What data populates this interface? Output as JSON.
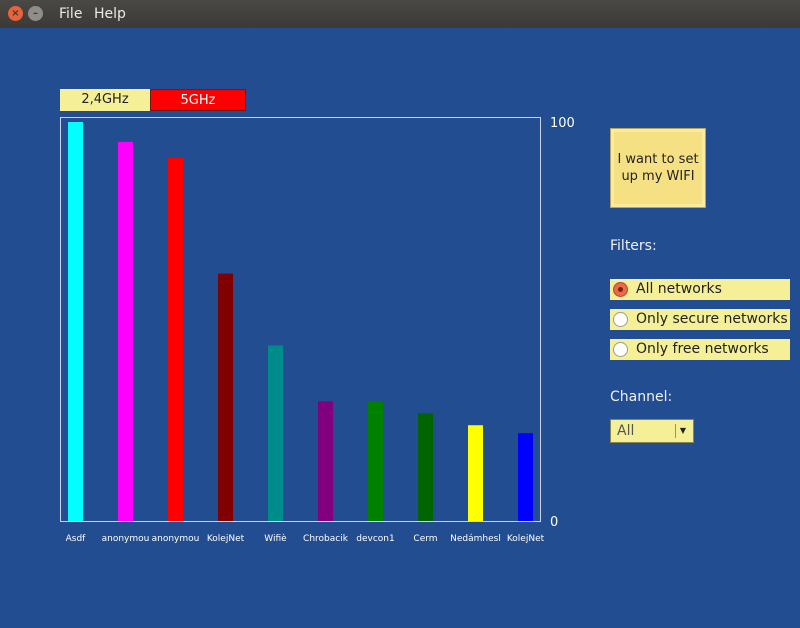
{
  "menu": {
    "file": "File",
    "help": "Help"
  },
  "bands": {
    "band_24": "2,4GHz",
    "band_5": "5GHz"
  },
  "setup_button_label": "I want to set up my WIFI",
  "filters": {
    "label": "Filters:",
    "options": [
      {
        "label": "All networks",
        "selected": true
      },
      {
        "label": "Only secure networks",
        "selected": false
      },
      {
        "label": "Only free networks",
        "selected": false
      }
    ]
  },
  "channel": {
    "label": "Channel:",
    "value": "All"
  },
  "chart_data": {
    "type": "bar",
    "categories": [
      "Asdf",
      "anonymou",
      "anonymou",
      "KolejNet",
      "Wifiè",
      "Chrobacik",
      "devcon1",
      "Cerm",
      "Nedámhesl",
      "KolejNet"
    ],
    "values": [
      100,
      95,
      91,
      62,
      44,
      30,
      30,
      27,
      24,
      22
    ],
    "colors": [
      "#00ffff",
      "#ff00ff",
      "#ff0000",
      "#800000",
      "#008b8b",
      "#800080",
      "#008000",
      "#006400",
      "#ffff00",
      "#0000ff"
    ],
    "ylim": [
      0,
      100
    ],
    "ytick_labels": [
      "100",
      "0"
    ]
  }
}
